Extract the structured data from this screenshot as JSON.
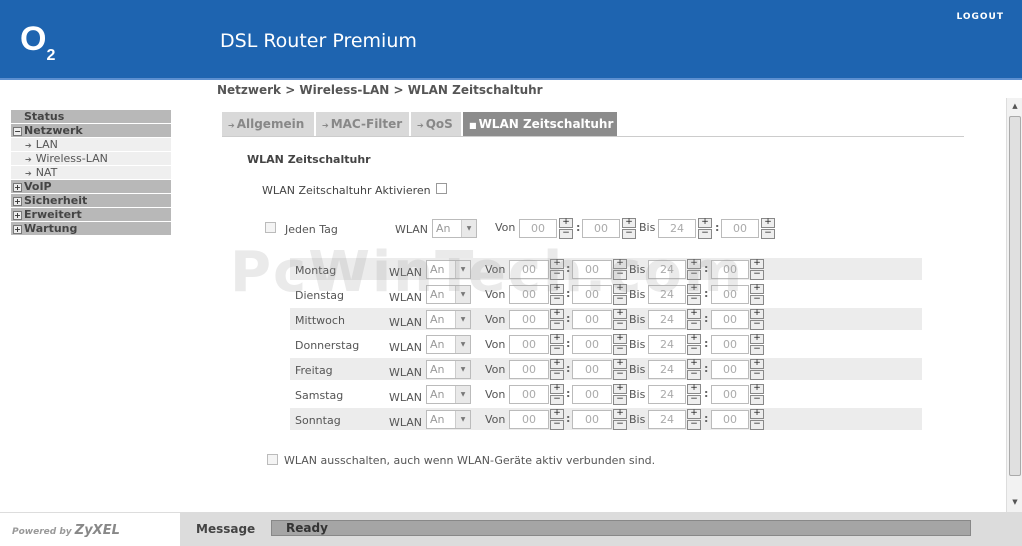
{
  "header": {
    "logo_main": "O",
    "logo_sub": "2",
    "product_title": "DSL Router Premium",
    "logout_label": "LOGOUT"
  },
  "breadcrumb": "Netzwerk > Wireless-LAN > WLAN Zeitschaltuhr",
  "sidebar": {
    "status": "Status",
    "netzwerk": "Netzwerk",
    "lan": "LAN",
    "wireless_lan": "Wireless-LAN",
    "nat": "NAT",
    "voip": "VoIP",
    "sicherheit": "Sicherheit",
    "erweitert": "Erweitert",
    "wartung": "Wartung"
  },
  "tabs": {
    "allgemein": "Allgemein",
    "mac_filter": "MAC-Filter",
    "qos": "QoS",
    "zeitschaltuhr": "WLAN Zeitschaltuhr"
  },
  "section_title": "WLAN Zeitschaltuhr",
  "activate_label": "WLAN Zeitschaltuhr Aktivieren",
  "labels": {
    "wlan": "WLAN",
    "von": "Von",
    "bis": "Bis",
    "colon": ":"
  },
  "jeden_tag": {
    "label": "Jeden Tag",
    "wlan_value": "An",
    "von_h": "00",
    "von_m": "00",
    "bis_h": "24",
    "bis_m": "00"
  },
  "days": [
    {
      "name": "Montag",
      "wlan": "An",
      "von_h": "00",
      "von_m": "00",
      "bis_h": "24",
      "bis_m": "00"
    },
    {
      "name": "Dienstag",
      "wlan": "An",
      "von_h": "00",
      "von_m": "00",
      "bis_h": "24",
      "bis_m": "00"
    },
    {
      "name": "Mittwoch",
      "wlan": "An",
      "von_h": "00",
      "von_m": "00",
      "bis_h": "24",
      "bis_m": "00"
    },
    {
      "name": "Donnerstag",
      "wlan": "An",
      "von_h": "00",
      "von_m": "00",
      "bis_h": "24",
      "bis_m": "00"
    },
    {
      "name": "Freitag",
      "wlan": "An",
      "von_h": "00",
      "von_m": "00",
      "bis_h": "24",
      "bis_m": "00"
    },
    {
      "name": "Samstag",
      "wlan": "An",
      "von_h": "00",
      "von_m": "00",
      "bis_h": "24",
      "bis_m": "00"
    },
    {
      "name": "Sonntag",
      "wlan": "An",
      "von_h": "00",
      "von_m": "00",
      "bis_h": "24",
      "bis_m": "00"
    }
  ],
  "disable_option": "WLAN ausschalten, auch wenn WLAN-Geräte aktiv verbunden sind.",
  "footer": {
    "powered_by": "Powered by",
    "brand": "ZyXEL",
    "message_label": "Message",
    "message_value": "Ready"
  },
  "watermark": "PcWinTech.com",
  "colors": {
    "header_blue": "#1e64b0",
    "active_tab": "#8c8c8c",
    "sidebar_main": "#b8b8b8"
  }
}
